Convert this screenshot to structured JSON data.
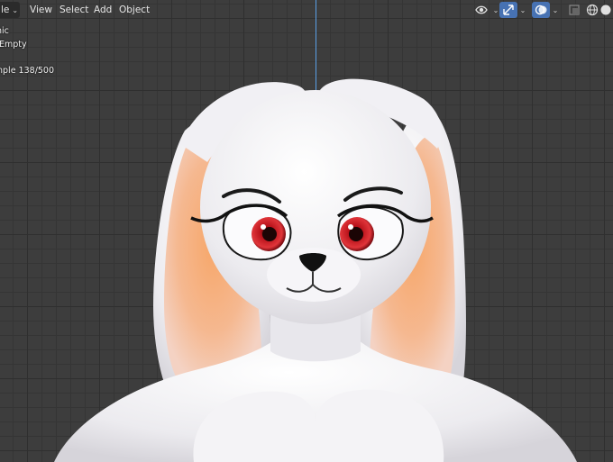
{
  "header": {
    "mode_label": "le",
    "menus": [
      "View",
      "Select",
      "Add",
      "Object"
    ]
  },
  "overlay": {
    "lines": [
      "hic",
      "Empty",
      "nple 138/500"
    ]
  },
  "icons": {
    "visibility": "eye-visibility-icon",
    "gizmo": "gizmo-arrow-icon",
    "overlays": "overlays-icon",
    "xray": "xray-toggle-icon",
    "wireframe": "wireframe-shading-icon",
    "solid": "solid-shading-icon"
  },
  "colors": {
    "accent": "#4772b3",
    "axis_y": "#5aa0e6",
    "grid_bg": "#3d3d3d"
  }
}
